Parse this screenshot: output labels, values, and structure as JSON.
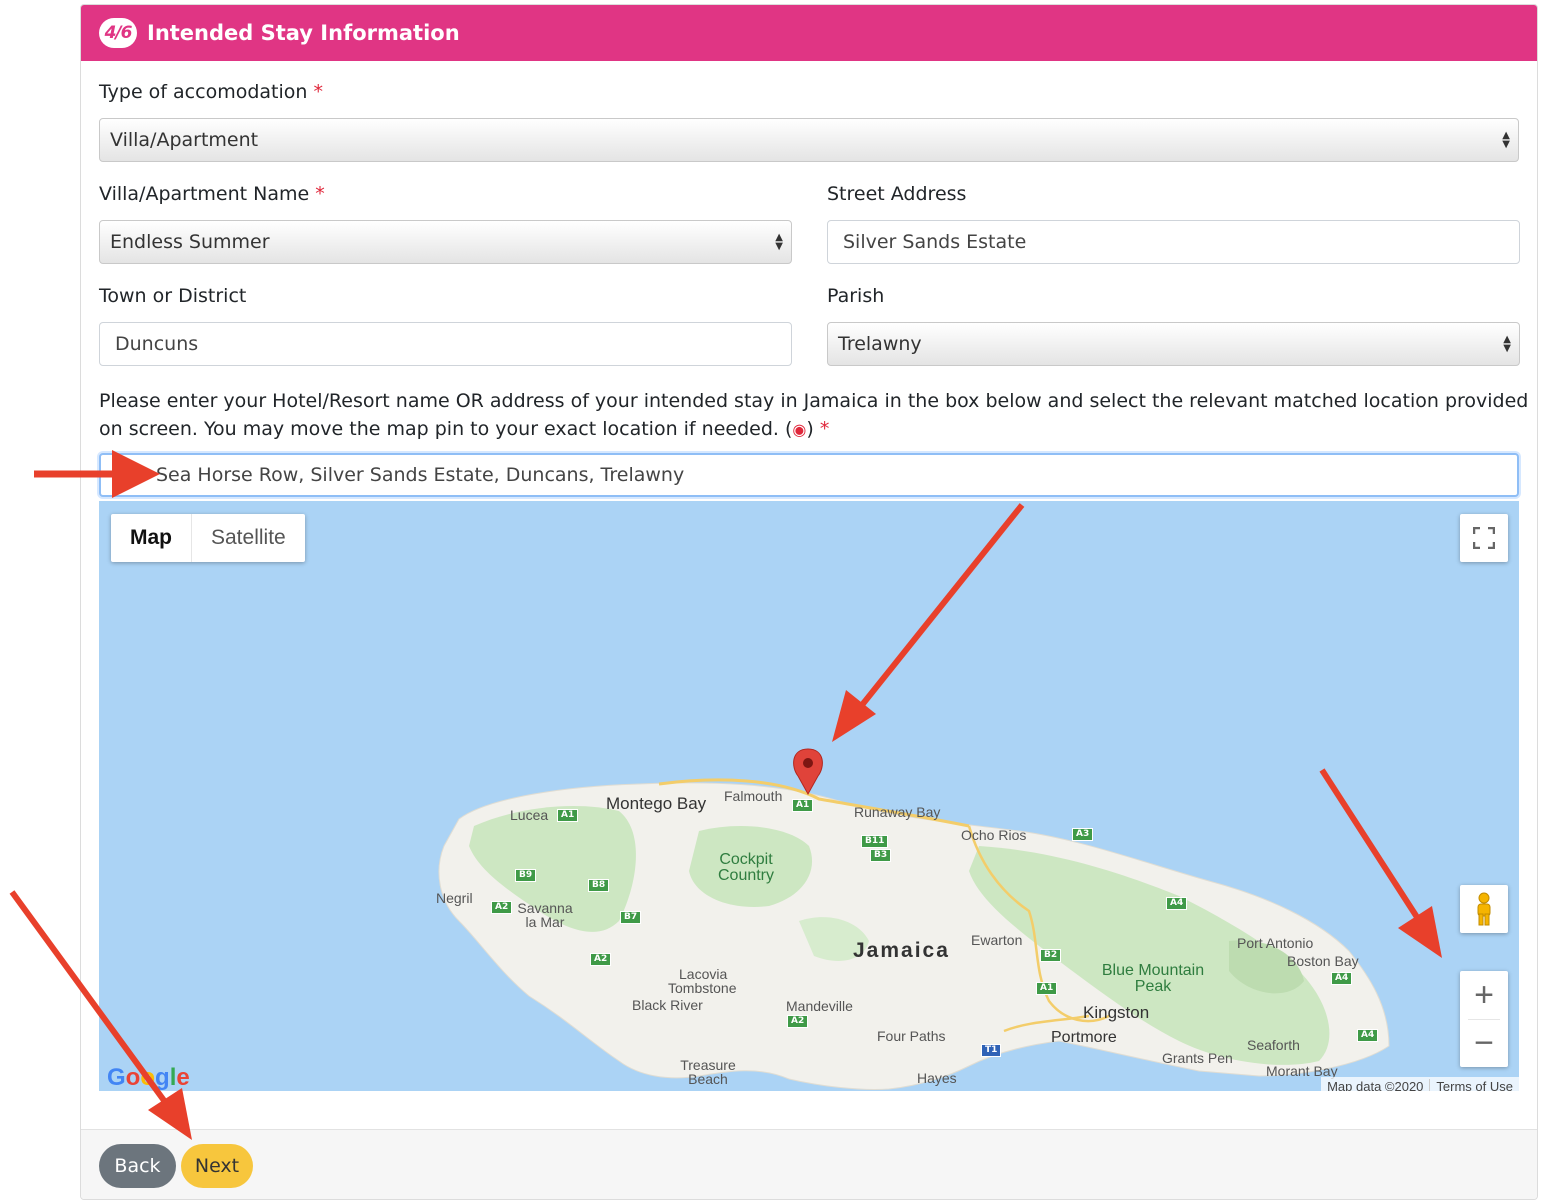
{
  "header": {
    "step": "4/6",
    "title": "Intended Stay Information"
  },
  "form": {
    "accommodation_type": {
      "label": "Type of accomodation",
      "required_mark": "*",
      "value": "Villa/Apartment"
    },
    "villa_name": {
      "label": "Villa/Apartment Name",
      "required_mark": "*",
      "value": "Endless Summer"
    },
    "street_address": {
      "label": "Street Address",
      "value": "Silver Sands Estate"
    },
    "town": {
      "label": "Town or District",
      "value": "Duncuns"
    },
    "parish": {
      "label": "Parish",
      "value": "Trelawny"
    },
    "instruction": "Please enter your Hotel/Resort name OR address of your intended stay in Jamaica in the box below and select the relevant matched location provided on screen. You may move the map pin to your exact location if needed. (",
    "instruction_end": ")",
    "instruction_required": "*",
    "location_search": {
      "value": "Sea Horse Row, Silver Sands Estate, Duncans, Trelawny"
    }
  },
  "map": {
    "type_buttons": [
      "Map",
      "Satellite"
    ],
    "active_type": "Map",
    "fullscreen_icon": "fullscreen-icon",
    "pegman_icon": "street-view-pegman-icon",
    "zoom_in": "+",
    "zoom_out": "−",
    "logo": "Google",
    "attribution": [
      "Map data ©2020",
      "Terms of Use"
    ],
    "country_label": "Jamaica",
    "places": {
      "montego_bay": "Montego Bay",
      "falmouth": "Falmouth",
      "lucea": "Lucea",
      "runaway_bay": "Runaway Bay",
      "ocho_rios": "Ocho Rios",
      "cockpit_country": "Cockpit Country",
      "negril": "Negril",
      "savanna_la_mar": "Savanna la Mar",
      "ewarton": "Ewarton",
      "port_antonio": "Port Antonio",
      "boston_bay": "Boston Bay",
      "blue_mountain_peak": "Blue Mountain Peak",
      "lacovia": "Lacovia",
      "tombstone": "Tombstone",
      "black_river": "Black River",
      "mandeville": "Mandeville",
      "kingston": "Kingston",
      "portmore": "Portmore",
      "four_paths": "Four Paths",
      "seaforth": "Seaforth",
      "grants_pen": "Grants Pen",
      "treasure_beach": "Treasure Beach",
      "hayes": "Hayes",
      "morant_bay": "Morant Bay"
    },
    "road_shields": [
      "A1",
      "A1",
      "B11",
      "B3",
      "A3",
      "B9",
      "B8",
      "A2",
      "B7",
      "A2",
      "A4",
      "B2",
      "A1",
      "A4",
      "A2",
      "T1",
      "A4"
    ]
  },
  "footer": {
    "back_label": "Back",
    "next_label": "Next"
  },
  "colors": {
    "header": "#e03584",
    "next_button": "#f7c63d",
    "back_button": "#6c757d",
    "annotation_arrow": "#e8402b",
    "map_water": "#abd3f5"
  }
}
